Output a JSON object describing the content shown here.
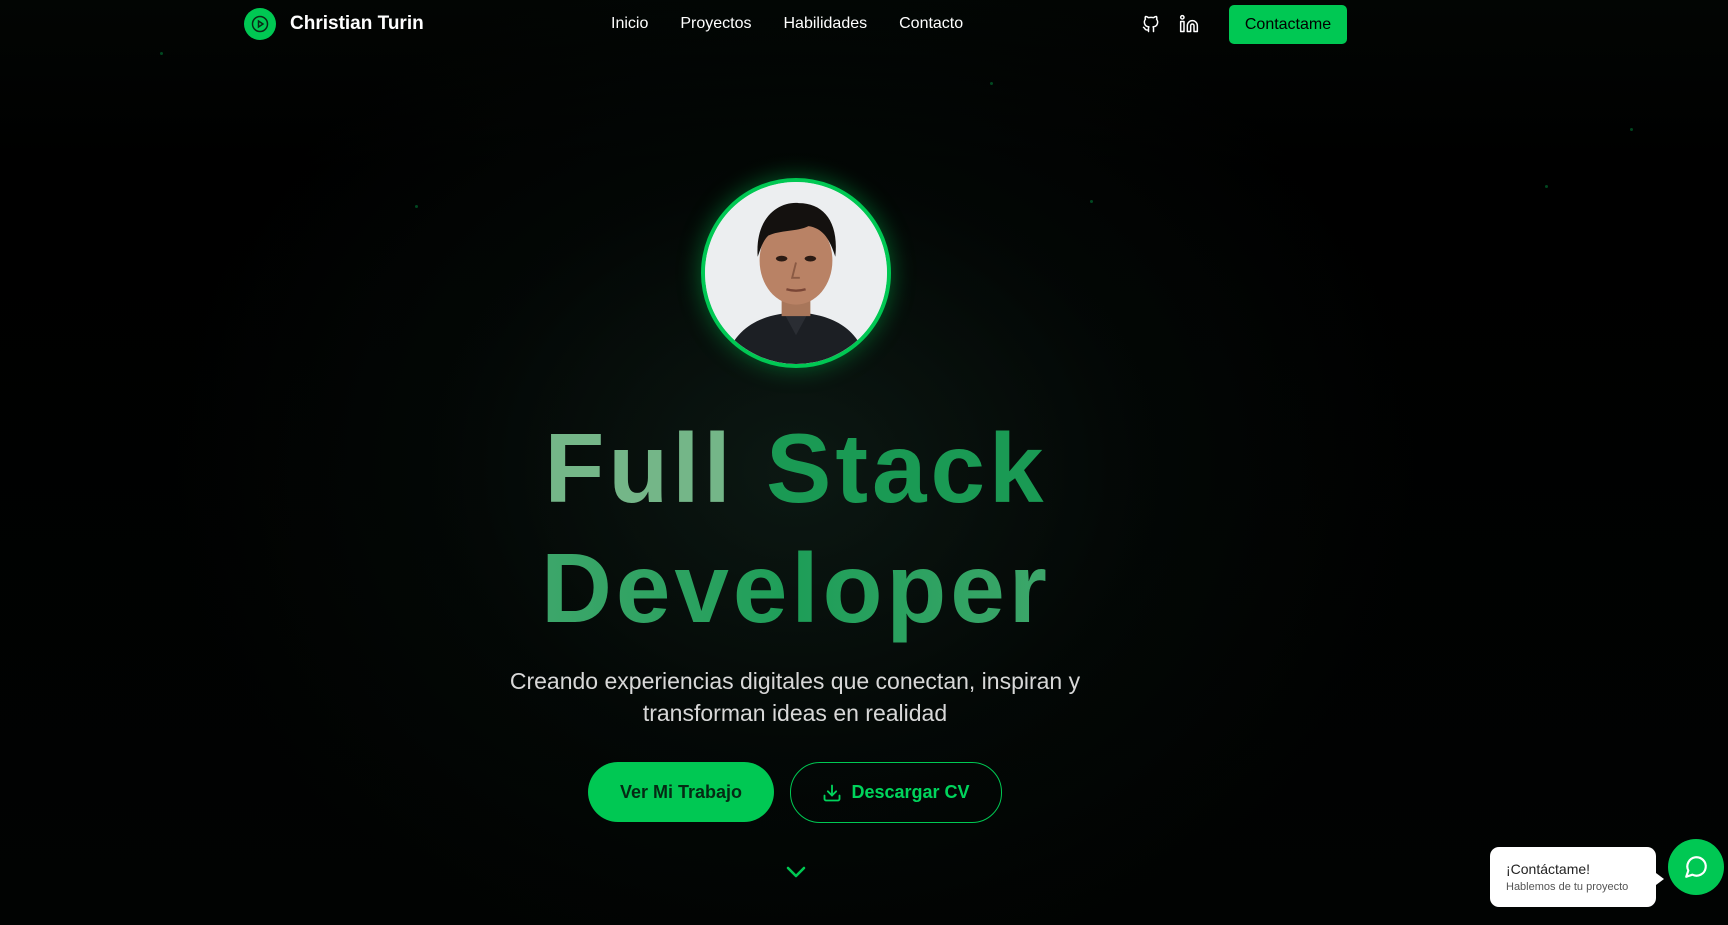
{
  "header": {
    "brand_name": "Christian Turin",
    "nav": [
      {
        "label": "Inicio"
      },
      {
        "label": "Proyectos"
      },
      {
        "label": "Habilidades"
      },
      {
        "label": "Contacto"
      }
    ],
    "social_icons": [
      "github-icon",
      "linkedin-icon"
    ],
    "cta_label": "Contactame"
  },
  "hero": {
    "headline_line1_word1": "Full",
    "headline_line1_word2": "Stack",
    "headline_line2": "Developer",
    "subtitle_line1": "Creando experiencias digitales que conectan, inspiran y",
    "subtitle_line2": "transforman ideas en realidad",
    "primary_button": "Ver Mi Trabajo",
    "secondary_button": "Descargar CV"
  },
  "chat_widget": {
    "title": "¡Contáctame!",
    "subtitle": "Hablemos de tu proyecto"
  },
  "colors": {
    "accent": "#00c853",
    "background": "#000000",
    "headline_light": "#74b688",
    "headline_dark": "#1a9a54"
  }
}
